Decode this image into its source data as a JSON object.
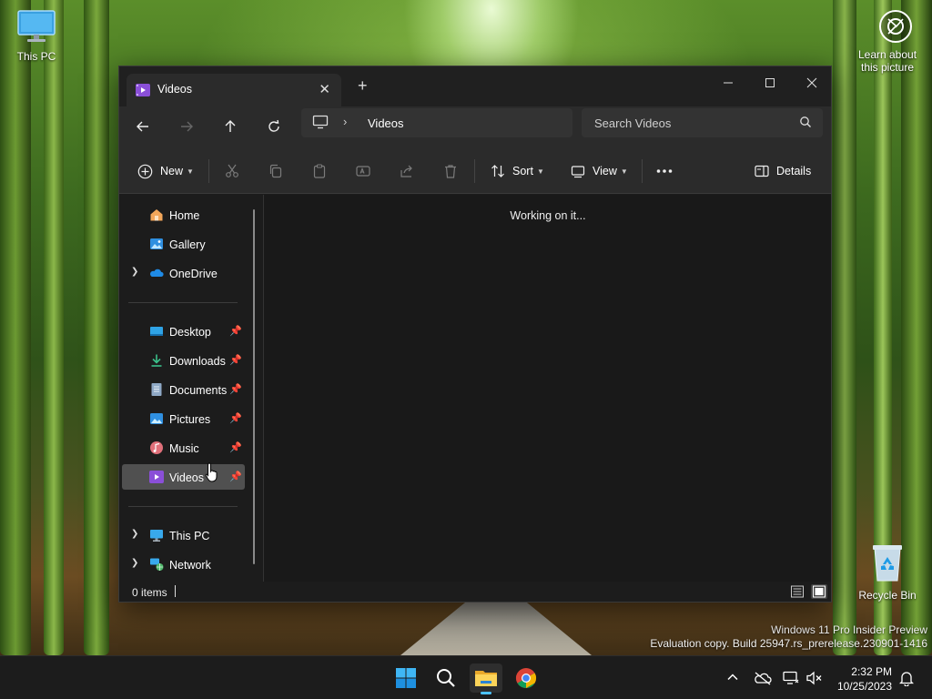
{
  "desktop": {
    "icons": [
      {
        "label": "This PC",
        "icon": "monitor-icon"
      },
      {
        "label": "Recycle Bin",
        "icon": "recycle-bin-icon"
      }
    ],
    "learn_about_picture": {
      "line1": "Learn about",
      "line2": "this picture",
      "icon": "camera-icon"
    },
    "watermark": {
      "line1": "Windows 11 Pro Insider Preview",
      "line2": "Evaluation copy. Build 25947.rs_prerelease.230901-1416"
    }
  },
  "explorer": {
    "tab": {
      "title": "Videos",
      "icon": "videos-folder-icon"
    },
    "window_controls": [
      "minimize",
      "maximize",
      "close"
    ],
    "address": {
      "root_icon": "pc-icon",
      "crumbs": [
        "Videos"
      ]
    },
    "search": {
      "placeholder": "Search Videos"
    },
    "toolbar": {
      "new_label": "New",
      "sort_label": "Sort",
      "view_label": "View",
      "details_label": "Details",
      "icons": [
        "cut-icon",
        "copy-icon",
        "paste-icon",
        "rename-icon",
        "share-icon",
        "delete-icon",
        "more-icon"
      ]
    },
    "nav": {
      "top": [
        {
          "label": "Home",
          "icon": "home-icon",
          "expandable": false
        },
        {
          "label": "Gallery",
          "icon": "gallery-icon",
          "expandable": false
        },
        {
          "label": "OneDrive",
          "icon": "onedrive-icon",
          "expandable": true
        }
      ],
      "quick_access": [
        {
          "label": "Desktop",
          "icon": "desktop-folder-icon",
          "pinned": true
        },
        {
          "label": "Downloads",
          "icon": "downloads-icon",
          "pinned": true
        },
        {
          "label": "Documents",
          "icon": "documents-icon",
          "pinned": true
        },
        {
          "label": "Pictures",
          "icon": "pictures-icon",
          "pinned": true
        },
        {
          "label": "Music",
          "icon": "music-icon",
          "pinned": true
        },
        {
          "label": "Videos",
          "icon": "videos-icon",
          "pinned": true,
          "selected": true
        }
      ],
      "bottom": [
        {
          "label": "This PC",
          "icon": "this-pc-icon",
          "expandable": true
        },
        {
          "label": "Network",
          "icon": "network-icon",
          "expandable": true
        }
      ]
    },
    "content": {
      "status_message": "Working on it..."
    },
    "statusbar": {
      "item_count": "0 items",
      "views": [
        "details-view",
        "tiles-view"
      ],
      "active_view": "tiles-view"
    }
  },
  "taskbar": {
    "apps": [
      "start-icon",
      "search-icon",
      "file-explorer-icon",
      "chrome-icon"
    ],
    "active_app": "file-explorer-icon",
    "tray_icons": [
      "chevron-up-icon",
      "onedrive-offline-icon",
      "network-icon",
      "volume-muted-icon"
    ],
    "time": "2:32 PM",
    "date": "10/25/2023",
    "notification_icon": "bell-icon"
  },
  "colors": {
    "window_bg": "#1c1c1c",
    "toolbar_bg": "#2b2b2b",
    "selection": "#505050",
    "accent": "#4cc2ff"
  }
}
